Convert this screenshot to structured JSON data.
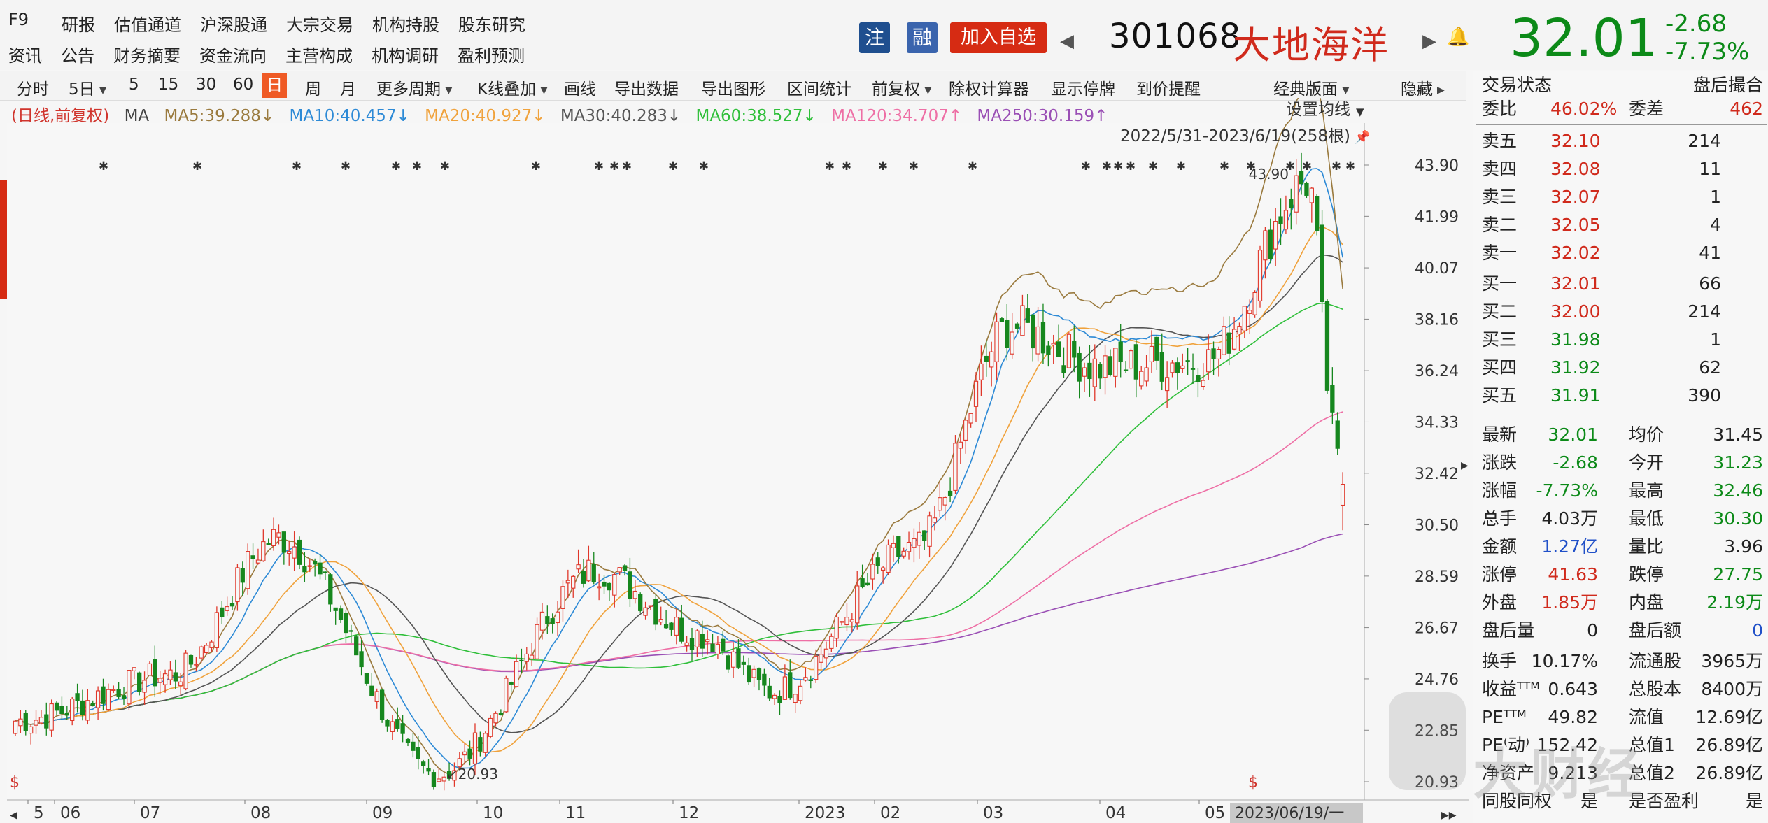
{
  "header": {
    "f9": "F9",
    "nav_row1": [
      "研报",
      "估值通道",
      "沪深股通",
      "大宗交易",
      "机构持股",
      "股东研究"
    ],
    "nav_row2": [
      "资讯",
      "公告",
      "财务摘要",
      "资金流向",
      "主营构成",
      "机构调研",
      "盈利预测"
    ],
    "badge_zhu": "注",
    "badge_rong": "融",
    "watch_button": "加入自选",
    "stock_code": "301068",
    "stock_name": "大地海洋",
    "last_price": "32.01",
    "change_abs": "-2.68",
    "change_pct": "-7.73%"
  },
  "toolbar": {
    "items": [
      "分时",
      "5日",
      "5",
      "15",
      "30",
      "60",
      "日",
      "周",
      "月",
      "更多周期",
      "K线叠加",
      "画线",
      "导出数据",
      "导出图形",
      "区间统计",
      "前复权",
      "除权计算器",
      "显示停牌",
      "到价提醒",
      "经典版面",
      "隐藏"
    ],
    "active": "日"
  },
  "ma_legend": {
    "prefix": "(日线,前复权)",
    "ma": "MA",
    "ma5": "MA5:39.288↓",
    "ma10": "MA10:40.457↓",
    "ma20": "MA20:40.927↓",
    "ma30": "MA30:40.283↓",
    "ma60": "MA60:38.527↓",
    "ma120": "MA120:34.707↑",
    "ma250": "MA250:30.159↑",
    "colors": {
      "ma5": "#9a7a3e",
      "ma10": "#2d8ad6",
      "ma20": "#f0a23c",
      "ma30": "#555555",
      "ma60": "#2fbf3a",
      "ma120": "#ee6fa5",
      "ma250": "#9a4fb5"
    }
  },
  "chart": {
    "settings_label": "设置均线",
    "range_label": "2022/5/31-2023/6/19(258根)",
    "high_label": "43.90",
    "low_label": "20.93",
    "y_ticks": [
      "43.90",
      "41.99",
      "40.07",
      "38.16",
      "36.24",
      "34.33",
      "32.42",
      "30.50",
      "28.59",
      "26.67",
      "24.76",
      "22.85",
      "20.93"
    ],
    "x_ticks": [
      "5",
      "06",
      "07",
      "08",
      "09",
      "10",
      "11",
      "12",
      "2023",
      "02",
      "03",
      "04",
      "05"
    ],
    "date_box": "2023/06/19/一"
  },
  "chart_data": {
    "type": "candlestick",
    "title": "",
    "ylim": [
      20.93,
      43.9
    ],
    "x_range": [
      "2022-05-31",
      "2023-06-19"
    ],
    "bar_count": 258,
    "keypoints": [
      {
        "date": "2022-05-31",
        "close": 23.2
      },
      {
        "date": "2022-07-15",
        "close": 24.9
      },
      {
        "date": "2022-08-15",
        "close": 30.0
      },
      {
        "date": "2022-09-30",
        "close": 21.2
      },
      {
        "date": "2022-11-15",
        "close": 28.8
      },
      {
        "date": "2022-12-15",
        "close": 26.4
      },
      {
        "date": "2023-01-05",
        "close": 24.3
      },
      {
        "date": "2023-02-15",
        "close": 29.6
      },
      {
        "date": "2023-03-15",
        "close": 37.9
      },
      {
        "date": "2023-04-10",
        "close": 36.4
      },
      {
        "date": "2023-05-10",
        "close": 36.6
      },
      {
        "date": "2023-06-09",
        "close": 43.3
      },
      {
        "date": "2023-06-16",
        "close": 34.7
      },
      {
        "date": "2023-06-19",
        "close": 32.01
      }
    ],
    "last_bar": {
      "open": 31.23,
      "high": 32.46,
      "low": 30.3,
      "close": 32.01
    },
    "ma_last": {
      "MA5": 39.288,
      "MA10": 40.457,
      "MA20": 40.927,
      "MA30": 40.283,
      "MA60": 38.527,
      "MA120": 34.707,
      "MA250": 30.159
    }
  },
  "panel": {
    "title": "交易状态",
    "title_right": "盘后撮合",
    "weibi_label": "委比",
    "weibi_value": "46.02%",
    "weicha_label": "委差",
    "weicha_value": "462",
    "sells": [
      {
        "label": "卖五",
        "price": "32.10",
        "vol": "214"
      },
      {
        "label": "卖四",
        "price": "32.08",
        "vol": "11"
      },
      {
        "label": "卖三",
        "price": "32.07",
        "vol": "1"
      },
      {
        "label": "卖二",
        "price": "32.05",
        "vol": "4"
      },
      {
        "label": "卖一",
        "price": "32.02",
        "vol": "41"
      }
    ],
    "buys": [
      {
        "label": "买一",
        "price": "32.01",
        "vol": "66"
      },
      {
        "label": "买二",
        "price": "32.00",
        "vol": "214"
      },
      {
        "label": "买三",
        "price": "31.98",
        "vol": "1"
      },
      {
        "label": "买四",
        "price": "31.92",
        "vol": "62"
      },
      {
        "label": "买五",
        "price": "31.91",
        "vol": "390"
      }
    ],
    "stats": [
      {
        "l1": "最新",
        "v1": "32.01",
        "c1": "green",
        "l2": "均价",
        "v2": "31.45",
        "c2": "dark"
      },
      {
        "l1": "涨跌",
        "v1": "-2.68",
        "c1": "green",
        "l2": "今开",
        "v2": "31.23",
        "c2": "green"
      },
      {
        "l1": "涨幅",
        "v1": "-7.73%",
        "c1": "green",
        "l2": "最高",
        "v2": "32.46",
        "c2": "green"
      },
      {
        "l1": "总手",
        "v1": "4.03万",
        "c1": "dark",
        "l2": "最低",
        "v2": "30.30",
        "c2": "green"
      },
      {
        "l1": "金额",
        "v1": "1.27亿",
        "c1": "blue",
        "l2": "量比",
        "v2": "3.96",
        "c2": "dark"
      },
      {
        "l1": "涨停",
        "v1": "41.63",
        "c1": "red",
        "l2": "跌停",
        "v2": "27.75",
        "c2": "green"
      },
      {
        "l1": "外盘",
        "v1": "1.85万",
        "c1": "red",
        "l2": "内盘",
        "v2": "2.19万",
        "c2": "green"
      },
      {
        "l1": "盘后量",
        "v1": "0",
        "c1": "dark",
        "l2": "盘后额",
        "v2": "0",
        "c2": "blue"
      }
    ],
    "fund": [
      {
        "l1": "换手",
        "v1": "10.17%",
        "l2": "流通股",
        "v2": "3965万"
      },
      {
        "l1": "收益ᵀᵀᴹ",
        "v1": "0.643",
        "l2": "总股本",
        "v2": "8400万"
      },
      {
        "l1": "PEᵀᵀᴹ",
        "v1": "49.82",
        "l2": "流值",
        "v2": "12.69亿"
      },
      {
        "l1": "PE⁽动⁾",
        "v1": "152.42",
        "l2": "总值1",
        "v2": "26.89亿"
      },
      {
        "l1": "净资产",
        "v1": "9.213",
        "l2": "总值2",
        "v2": "26.89亿"
      },
      {
        "l1": "同股同权",
        "v1": "是",
        "l2": "是否盈利",
        "v2": "是"
      }
    ]
  },
  "watermark": "大财经"
}
